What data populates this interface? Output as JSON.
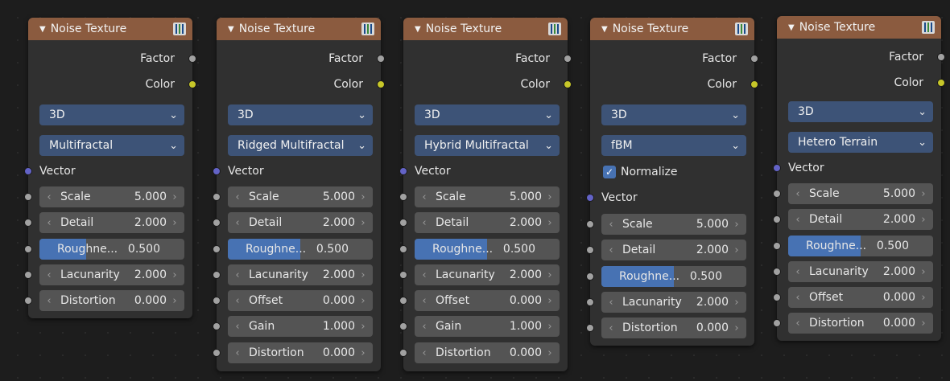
{
  "nodes": [
    {
      "title": "Noise Texture",
      "outputs": [
        "Factor",
        "Color"
      ],
      "dimensions": "3D",
      "type": "Multifractal",
      "vector_label": "Vector",
      "fields": [
        {
          "name": "Scale",
          "value": "5.000"
        },
        {
          "name": "Detail",
          "value": "2.000"
        },
        {
          "name": "Roughne...",
          "value": "0.500",
          "slider": 0.5
        },
        {
          "name": "Lacunarity",
          "value": "2.000"
        },
        {
          "name": "Distortion",
          "value": "0.000"
        }
      ]
    },
    {
      "title": "Noise Texture",
      "outputs": [
        "Factor",
        "Color"
      ],
      "dimensions": "3D",
      "type": "Ridged Multifractal",
      "vector_label": "Vector",
      "fields": [
        {
          "name": "Scale",
          "value": "5.000"
        },
        {
          "name": "Detail",
          "value": "2.000"
        },
        {
          "name": "Roughne...",
          "value": "0.500",
          "slider": 0.5
        },
        {
          "name": "Lacunarity",
          "value": "2.000"
        },
        {
          "name": "Offset",
          "value": "0.000"
        },
        {
          "name": "Gain",
          "value": "1.000"
        },
        {
          "name": "Distortion",
          "value": "0.000"
        }
      ]
    },
    {
      "title": "Noise Texture",
      "outputs": [
        "Factor",
        "Color"
      ],
      "dimensions": "3D",
      "type": "Hybrid Multifractal",
      "vector_label": "Vector",
      "fields": [
        {
          "name": "Scale",
          "value": "5.000"
        },
        {
          "name": "Detail",
          "value": "2.000"
        },
        {
          "name": "Roughne...",
          "value": "0.500",
          "slider": 0.5
        },
        {
          "name": "Lacunarity",
          "value": "2.000"
        },
        {
          "name": "Offset",
          "value": "0.000"
        },
        {
          "name": "Gain",
          "value": "1.000"
        },
        {
          "name": "Distortion",
          "value": "0.000"
        }
      ]
    },
    {
      "title": "Noise Texture",
      "outputs": [
        "Factor",
        "Color"
      ],
      "dimensions": "3D",
      "type": "fBM",
      "normalize_label": "Normalize",
      "normalize_checked": true,
      "vector_label": "Vector",
      "fields": [
        {
          "name": "Scale",
          "value": "5.000"
        },
        {
          "name": "Detail",
          "value": "2.000"
        },
        {
          "name": "Roughne...",
          "value": "0.500",
          "slider": 0.5
        },
        {
          "name": "Lacunarity",
          "value": "2.000"
        },
        {
          "name": "Distortion",
          "value": "0.000"
        }
      ]
    },
    {
      "title": "Noise Texture",
      "outputs": [
        "Factor",
        "Color"
      ],
      "dimensions": "3D",
      "type": "Hetero Terrain",
      "vector_label": "Vector",
      "fields": [
        {
          "name": "Scale",
          "value": "5.000"
        },
        {
          "name": "Detail",
          "value": "2.000"
        },
        {
          "name": "Roughne...",
          "value": "0.500",
          "slider": 0.5
        },
        {
          "name": "Lacunarity",
          "value": "2.000"
        },
        {
          "name": "Offset",
          "value": "0.000"
        },
        {
          "name": "Distortion",
          "value": "0.000"
        }
      ]
    }
  ],
  "colors": {
    "header": "#8b5b3f",
    "dropdown": "#3d5377",
    "slider_fill": "#4772b3",
    "socket_grey": "#a1a1a1",
    "socket_yellow": "#c7c729",
    "socket_purple": "#6363c7"
  }
}
